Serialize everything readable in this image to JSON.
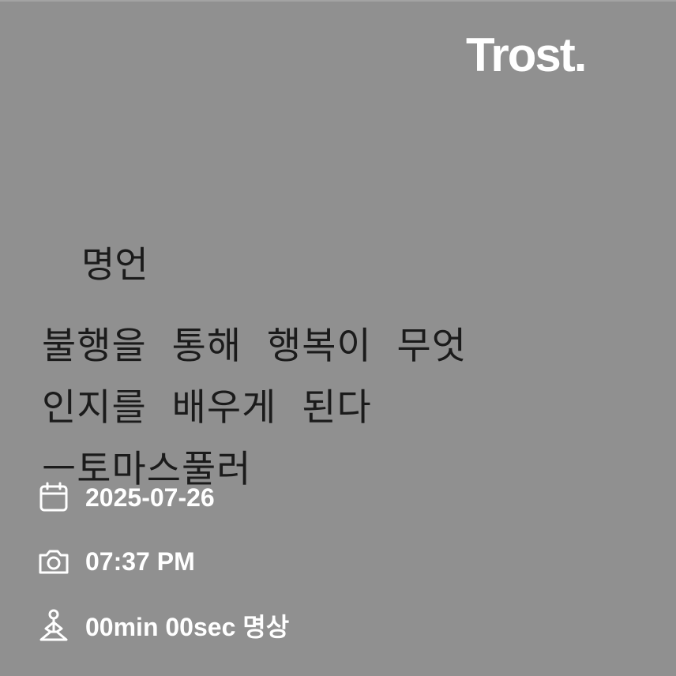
{
  "brand": {
    "logo": "Trost."
  },
  "note": {
    "title": "명언",
    "lines": [
      "불행을  통해  행복이  무엇",
      "인지를  배우게  된다",
      "ㅡ토마스풀러"
    ]
  },
  "meta": {
    "date": {
      "icon": "calendar-icon",
      "text": "2025-07-26"
    },
    "time": {
      "icon": "camera-icon",
      "text": "07:37 PM"
    },
    "meditation": {
      "icon": "meditation-icon",
      "text": "00min 00sec 명상"
    }
  },
  "colors": {
    "background": "#909090",
    "text_dark": "#1b1b1b",
    "text_light": "#ffffff"
  }
}
